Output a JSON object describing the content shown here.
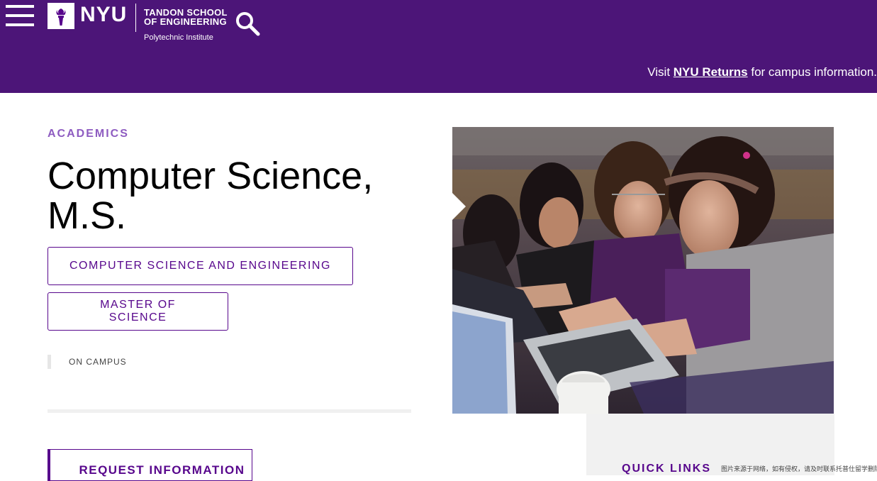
{
  "header": {
    "logo_word": "NYU",
    "school_line1": "TANDON SCHOOL",
    "school_line2": "OF ENGINEERING",
    "school_sub": "Polytechnic Institute",
    "notice_prefix": "Visit ",
    "notice_link": "NYU Returns",
    "notice_suffix": " for campus information.",
    "brand_color": "#4c1578"
  },
  "program": {
    "eyebrow": "ACADEMICS",
    "title_line1": "Computer Science,",
    "title_line2": "M.S.",
    "tags": [
      "COMPUTER SCIENCE AND ENGINEERING",
      "MASTER OF SCIENCE"
    ],
    "mode": "ON CAMPUS",
    "request_label": "REQUEST INFORMATION"
  },
  "quick_links": {
    "title": "QUICK LINKS"
  },
  "watermark": "图片来源于网络，如有侵权，请及时联系托普仕留学删除"
}
